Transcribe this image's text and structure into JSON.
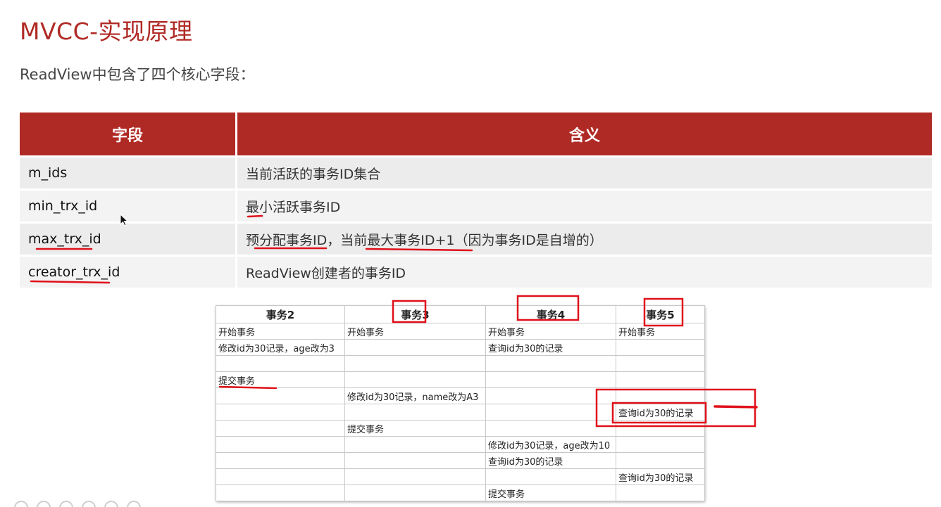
{
  "slide": {
    "title": "MVCC-实现原理",
    "subtitle": "ReadView中包含了四个核心字段："
  },
  "fields_table": {
    "headers": [
      "字段",
      "含义"
    ],
    "rows": [
      {
        "field": "m_ids",
        "meaning": "当前活跃的事务ID集合"
      },
      {
        "field": "min_trx_id",
        "meaning": "最小活跃事务ID"
      },
      {
        "field": "max_trx_id",
        "meaning": "预分配事务ID，当前最大事务ID+1（因为事务ID是自增的）"
      },
      {
        "field": "creator_trx_id",
        "meaning": "ReadView创建者的事务ID"
      }
    ]
  },
  "tx_table": {
    "headers": [
      "事务2",
      "事务3",
      "事务4",
      "事务5"
    ],
    "rows": [
      [
        "开始事务",
        "开始事务",
        "开始事务",
        "开始事务"
      ],
      [
        "修改id为30记录，age改为3",
        "",
        "查询id为30的记录",
        ""
      ],
      [
        "",
        "",
        "",
        ""
      ],
      [
        "提交事务",
        "",
        "",
        ""
      ],
      [
        "",
        "修改id为30记录，name改为A3",
        "",
        ""
      ],
      [
        "",
        "",
        "",
        "查询id为30的记录"
      ],
      [
        "",
        "提交事务",
        "",
        ""
      ],
      [
        "",
        "",
        "修改id为30记录，age改为10",
        ""
      ],
      [
        "",
        "",
        "查询id为30的记录",
        ""
      ],
      [
        "",
        "",
        "",
        "查询id为30的记录"
      ],
      [
        "",
        "",
        "提交事务",
        ""
      ]
    ]
  },
  "annotation_color": "#e0101a",
  "icons": {
    "cursor": "mouse-pointer-icon"
  }
}
